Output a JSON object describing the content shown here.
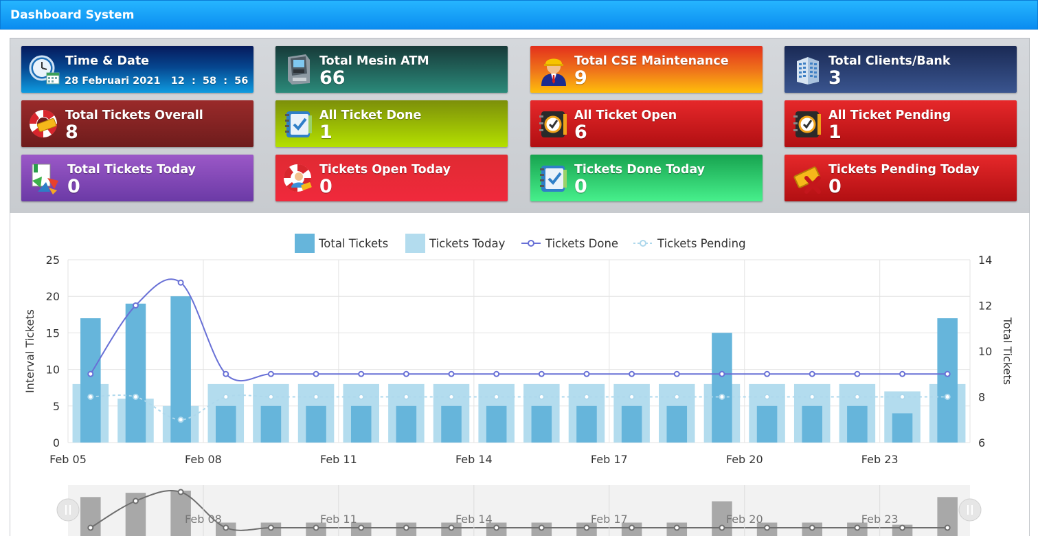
{
  "window": {
    "title": "Dashboard System"
  },
  "cards": {
    "time_date": {
      "label": "Time & Date",
      "date": "28 Februari 2021",
      "hh": "12",
      "mm": "58",
      "ss": "56",
      "sep": ":",
      "icon": "clock-calendar-icon"
    },
    "total_atm": {
      "label": "Total Mesin ATM",
      "value": "66",
      "icon": "atm-machine-icon"
    },
    "total_cse": {
      "label": "Total CSE Maintenance",
      "value": "9",
      "icon": "engineer-icon"
    },
    "total_clients": {
      "label": "Total Clients/Bank",
      "value": "3",
      "icon": "building-icon"
    },
    "tickets_overall": {
      "label": "Total Tickets Overall",
      "value": "8",
      "icon": "lifebuoy-ticket-icon"
    },
    "all_done": {
      "label": "All Ticket Done",
      "value": "1",
      "icon": "planner-check-icon"
    },
    "all_open": {
      "label": "All Ticket Open",
      "value": "6",
      "icon": "planner-clock-icon"
    },
    "all_pending": {
      "label": "All Ticket Pending",
      "value": "1",
      "icon": "planner-clock-icon"
    },
    "tickets_today": {
      "label": "Total Tickets Today",
      "value": "0",
      "icon": "recycle-book-icon"
    },
    "open_today": {
      "label": "Tickets Open Today",
      "value": "0",
      "icon": "lifebuoy-user-icon"
    },
    "done_today": {
      "label": "Tickets Done Today",
      "value": "0",
      "icon": "planner-check-icon"
    },
    "pending_today": {
      "label": "Tickets Pending Today",
      "value": "0",
      "icon": "ticket-cross-icon"
    }
  },
  "colors": {
    "total_tickets": "#66b5db",
    "tickets_today": "#b3dcee",
    "tickets_done": "#6870d6",
    "tickets_pending": "#aed8ec",
    "navigator": "#a8a8a8"
  },
  "chart_data": {
    "type": "bar",
    "legend": [
      "Total Tickets",
      "Tickets Today",
      "Tickets Done",
      "Tickets Pending"
    ],
    "legend_placement": "top-center",
    "ylabel": "Interval Tickets",
    "y2label": "Total Tickets",
    "ylim": [
      0,
      25
    ],
    "y2lim": [
      6,
      14
    ],
    "yticks": [
      "0",
      "5",
      "10",
      "15",
      "20",
      "25"
    ],
    "y2ticks": [
      "6",
      "8",
      "10",
      "12",
      "14"
    ],
    "x_tick_labels": [
      "Feb 05",
      "Feb 08",
      "Feb 11",
      "Feb 14",
      "Feb 17",
      "Feb 20",
      "Feb 23"
    ],
    "navigator_tick_labels": [
      "Feb 08",
      "Feb 11",
      "Feb 14",
      "Feb 17",
      "Feb 20",
      "Feb 23"
    ],
    "x": [
      "2021-02-05",
      "2021-02-06",
      "2021-02-07",
      "2021-02-08",
      "2021-02-09",
      "2021-02-10",
      "2021-02-11",
      "2021-02-12",
      "2021-02-13",
      "2021-02-14",
      "2021-02-15",
      "2021-02-16",
      "2021-02-17",
      "2021-02-18",
      "2021-02-19",
      "2021-02-20",
      "2021-02-21",
      "2021-02-22",
      "2021-02-23",
      "2021-02-24"
    ],
    "grid": true,
    "series": [
      {
        "name": "Total Tickets",
        "type": "bar",
        "axis": "left",
        "values": [
          17,
          19,
          20,
          5,
          5,
          5,
          5,
          5,
          5,
          5,
          5,
          5,
          5,
          5,
          15,
          5,
          5,
          5,
          4,
          17
        ]
      },
      {
        "name": "Tickets Today",
        "type": "bar",
        "axis": "left",
        "values": [
          8,
          6,
          5,
          8,
          8,
          8,
          8,
          8,
          8,
          8,
          8,
          8,
          8,
          8,
          8,
          8,
          8,
          8,
          7,
          8
        ]
      },
      {
        "name": "Tickets Done",
        "type": "line",
        "axis": "right",
        "values": [
          9,
          12,
          13,
          9,
          9,
          9,
          9,
          9,
          9,
          9,
          9,
          9,
          9,
          9,
          9,
          9,
          9,
          9,
          9,
          9
        ]
      },
      {
        "name": "Tickets Pending",
        "type": "line",
        "axis": "right",
        "values": [
          8,
          8,
          7,
          8,
          8,
          8,
          8,
          8,
          8,
          8,
          8,
          8,
          8,
          8,
          8,
          8,
          8,
          8,
          8,
          8
        ]
      }
    ]
  }
}
